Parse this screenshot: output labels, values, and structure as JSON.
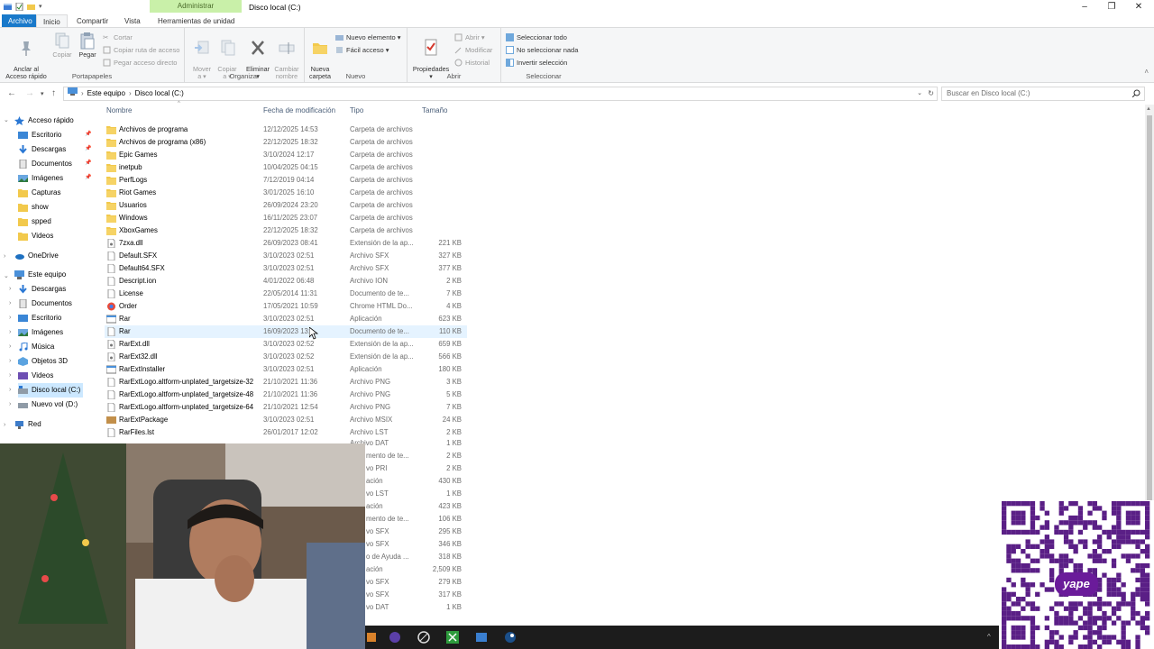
{
  "window": {
    "title": "Disco local (C:)",
    "context_tab": "Administrar"
  },
  "ribbon_tabs": [
    "Archivo",
    "Inicio",
    "Compartir",
    "Vista",
    "Herramientas de unidad"
  ],
  "ribbon": {
    "portapapeles": {
      "label": "Portapapeles",
      "pin": "Anclar al\nAcceso rápido",
      "copy": "Copiar",
      "paste": "Pegar",
      "cut": "Cortar",
      "copy_path": "Copiar ruta de acceso",
      "paste_shortcut": "Pegar acceso directo"
    },
    "organizar": {
      "label": "Organizar",
      "move": "Mover\na ▾",
      "copy_to": "Copiar\na ▾",
      "delete": "Eliminar\n▾",
      "rename": "Cambiar\nnombre"
    },
    "nuevo": {
      "label": "Nuevo",
      "new_folder": "Nueva\ncarpeta",
      "new_item": "Nuevo elemento ▾",
      "easy_access": "Fácil acceso ▾"
    },
    "abrir": {
      "label": "Abrir",
      "properties": "Propiedades\n▾",
      "open": "Abrir ▾",
      "edit": "Modificar",
      "history": "Historial"
    },
    "seleccionar": {
      "label": "Seleccionar",
      "all": "Seleccionar todo",
      "none": "No seleccionar nada",
      "invert": "Invertir selección"
    }
  },
  "address": {
    "crumbs": [
      "Este equipo",
      "Disco local (C:)"
    ],
    "search_placeholder": "Buscar en Disco local (C:)"
  },
  "nav": {
    "quick_access": "Acceso rápido",
    "quick_items": [
      "Escritorio",
      "Descargas",
      "Documentos",
      "Imágenes",
      "Capturas",
      "show",
      "spped",
      "Videos"
    ],
    "onedrive": "OneDrive",
    "this_pc": "Este equipo",
    "pc_items": [
      "Descargas",
      "Documentos",
      "Escritorio",
      "Imágenes",
      "Música",
      "Objetos 3D",
      "Videos",
      "Disco local (C:)",
      "Nuevo vol (D:)"
    ],
    "network": "Red"
  },
  "columns": {
    "name": "Nombre",
    "date": "Fecha de modificación",
    "type": "Tipo",
    "size": "Tamaño"
  },
  "files": [
    {
      "name": "Archivos de programa",
      "date": "12/12/2025 14:53",
      "type": "Carpeta de archivos",
      "size": "",
      "kind": "folder"
    },
    {
      "name": "Archivos de programa (x86)",
      "date": "22/12/2025 18:32",
      "type": "Carpeta de archivos",
      "size": "",
      "kind": "folder"
    },
    {
      "name": "Epic Games",
      "date": "3/10/2024 12:17",
      "type": "Carpeta de archivos",
      "size": "",
      "kind": "folder"
    },
    {
      "name": "inetpub",
      "date": "10/04/2025 04:15",
      "type": "Carpeta de archivos",
      "size": "",
      "kind": "folder"
    },
    {
      "name": "PerfLogs",
      "date": "7/12/2019 04:14",
      "type": "Carpeta de archivos",
      "size": "",
      "kind": "folder"
    },
    {
      "name": "Riot Games",
      "date": "3/01/2025 16:10",
      "type": "Carpeta de archivos",
      "size": "",
      "kind": "folder"
    },
    {
      "name": "Usuarios",
      "date": "26/09/2024 23:20",
      "type": "Carpeta de archivos",
      "size": "",
      "kind": "folder"
    },
    {
      "name": "Windows",
      "date": "16/11/2025 23:07",
      "type": "Carpeta de archivos",
      "size": "",
      "kind": "folder"
    },
    {
      "name": "XboxGames",
      "date": "22/12/2025 18:32",
      "type": "Carpeta de archivos",
      "size": "",
      "kind": "folder"
    },
    {
      "name": "7zxa.dll",
      "date": "26/09/2023 08:41",
      "type": "Extensión de la ap...",
      "size": "221 KB",
      "kind": "dll"
    },
    {
      "name": "Default.SFX",
      "date": "3/10/2023 02:51",
      "type": "Archivo SFX",
      "size": "327 KB",
      "kind": "file"
    },
    {
      "name": "Default64.SFX",
      "date": "3/10/2023 02:51",
      "type": "Archivo SFX",
      "size": "377 KB",
      "kind": "file"
    },
    {
      "name": "Descript.ion",
      "date": "4/01/2022 06:48",
      "type": "Archivo ION",
      "size": "2 KB",
      "kind": "file"
    },
    {
      "name": "License",
      "date": "22/05/2014 11:31",
      "type": "Documento de te...",
      "size": "7 KB",
      "kind": "file"
    },
    {
      "name": "Order",
      "date": "17/05/2021 10:59",
      "type": "Chrome HTML Do...",
      "size": "4 KB",
      "kind": "chrome"
    },
    {
      "name": "Rar",
      "date": "3/10/2023 02:51",
      "type": "Aplicación",
      "size": "623 KB",
      "kind": "app"
    },
    {
      "name": "Rar",
      "date": "16/09/2023 13:...",
      "type": "Documento de te...",
      "size": "110 KB",
      "kind": "file"
    },
    {
      "name": "RarExt.dll",
      "date": "3/10/2023 02:52",
      "type": "Extensión de la ap...",
      "size": "659 KB",
      "kind": "dll"
    },
    {
      "name": "RarExt32.dll",
      "date": "3/10/2023 02:52",
      "type": "Extensión de la ap...",
      "size": "566 KB",
      "kind": "dll"
    },
    {
      "name": "RarExtInstaller",
      "date": "3/10/2023 02:51",
      "type": "Aplicación",
      "size": "180 KB",
      "kind": "app"
    },
    {
      "name": "RarExtLogo.altform-unplated_targetsize-32",
      "date": "21/10/2021 11:36",
      "type": "Archivo PNG",
      "size": "3 KB",
      "kind": "file"
    },
    {
      "name": "RarExtLogo.altform-unplated_targetsize-48",
      "date": "21/10/2021 11:36",
      "type": "Archivo PNG",
      "size": "5 KB",
      "kind": "file"
    },
    {
      "name": "RarExtLogo.altform-unplated_targetsize-64",
      "date": "21/10/2021 12:54",
      "type": "Archivo PNG",
      "size": "7 KB",
      "kind": "file"
    },
    {
      "name": "RarExtPackage",
      "date": "3/10/2023 02:51",
      "type": "Archivo MSIX",
      "size": "24 KB",
      "kind": "package"
    },
    {
      "name": "RarFiles.lst",
      "date": "26/01/2017 12:02",
      "type": "Archivo LST",
      "size": "2 KB",
      "kind": "file"
    }
  ],
  "partial_rows": [
    {
      "type": "Archivo DAT",
      "size": "1 KB"
    },
    {
      "type": "mento de te...",
      "size": "2 KB"
    },
    {
      "type": "vo PRI",
      "size": "2 KB"
    },
    {
      "type": "ación",
      "size": "430 KB"
    },
    {
      "type": "vo LST",
      "size": "1 KB"
    },
    {
      "type": "ación",
      "size": "423 KB"
    },
    {
      "type": "mento de te...",
      "size": "106 KB"
    },
    {
      "type": "vo SFX",
      "size": "295 KB"
    },
    {
      "type": "vo SFX",
      "size": "346 KB"
    },
    {
      "type": "o de Ayuda ...",
      "size": "318 KB"
    },
    {
      "type": "ación",
      "size": "2,509 KB"
    },
    {
      "type": "vo SFX",
      "size": "279 KB"
    },
    {
      "type": "vo SFX",
      "size": "317 KB"
    },
    {
      "type": "vo DAT",
      "size": "1 KB"
    }
  ],
  "colors": {
    "accent": "#1979ca",
    "folder": "#f2c94c",
    "selection": "#cce8ff",
    "context_tab": "#c9f0a9"
  },
  "overlay": {
    "qr_brand": "yape"
  }
}
